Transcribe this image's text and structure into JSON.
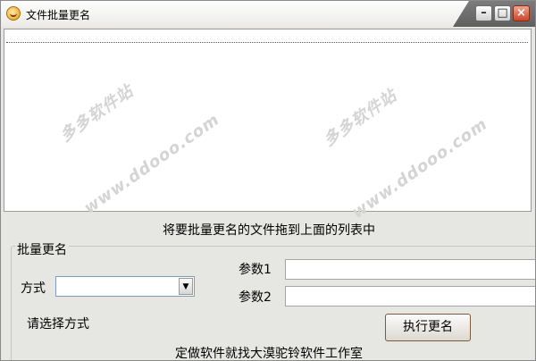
{
  "window": {
    "title": "文件批量更名"
  },
  "file_list": {
    "hint": "将要批量更名的文件拖到上面的列表中",
    "watermarks": [
      "多多软件站",
      "www.ddooo.com"
    ]
  },
  "group": {
    "title": "批量更名"
  },
  "form": {
    "mode_label": "方式",
    "mode_value": "",
    "mode_status": "请选择方式",
    "param1_label": "参数1",
    "param1_value": "",
    "param2_label": "参数2",
    "param2_value": "",
    "run_button": "执行更名"
  },
  "footer": {
    "credit": "定做软件就找大漠驼铃软件工作室"
  }
}
